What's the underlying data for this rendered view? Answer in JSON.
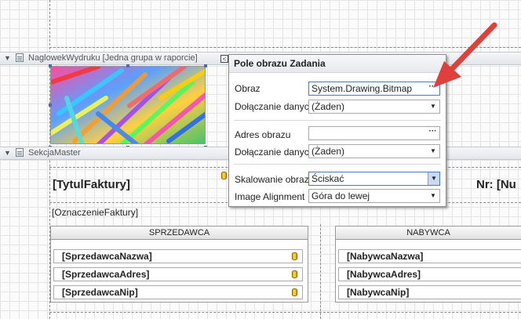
{
  "bands": {
    "header_label": "NaglowekWydruku [Jedna grupa w raporcie]",
    "master_label": "SekcjaMaster"
  },
  "fields": {
    "title": "[TytulFaktury]",
    "number": "Nr: [Nu",
    "designation": "[OznaczenieFaktury]"
  },
  "seller": {
    "header": "SPRZEDAWCA",
    "rows": [
      "[SprzedawcaNazwa]",
      "[SprzedawcaAdres]",
      "[SprzedawcaNip]"
    ]
  },
  "buyer": {
    "header": "NABYWCA",
    "rows": [
      "[NabywcaNazwa]",
      "[NabywcaAdres]",
      "[NabywcaNip]"
    ]
  },
  "popup": {
    "title": "Pole obrazu Zadania",
    "image_label": "Obraz",
    "image_value": "System.Drawing.Bitmap",
    "binding1_label": "Dołączanie danych",
    "binding1_value": "(Żaden)",
    "url_label": "Adres obrazu",
    "url_value": "",
    "binding2_label": "Dołączanie danych",
    "binding2_value": "(Żaden)",
    "sizing_label": "Skalowanie obrazu",
    "sizing_value": "Ściskać",
    "align_label": "Image Alignment",
    "align_value": "Góra do lewej",
    "ellipsis": "···",
    "smart_tag": "<"
  },
  "colors": {
    "arrow": "#e0403c",
    "accent": "#4a78c0"
  }
}
